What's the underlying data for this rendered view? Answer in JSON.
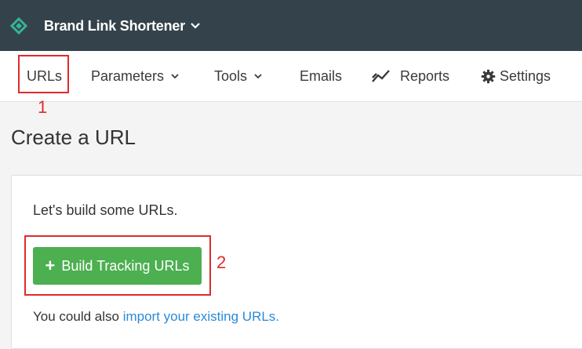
{
  "header": {
    "brand_name": "Brand Link Shortener",
    "brand_color": "#35b39a",
    "background": "#34434b"
  },
  "nav": {
    "items": [
      {
        "label": "URLs",
        "icon": null,
        "dropdown": false
      },
      {
        "label": "Parameters",
        "icon": "chevron-down-icon",
        "dropdown": true
      },
      {
        "label": "Tools",
        "icon": "chevron-down-icon",
        "dropdown": true
      },
      {
        "label": "Emails",
        "icon": null,
        "dropdown": false
      },
      {
        "label": "Reports",
        "icon": "line-chart-icon",
        "dropdown": false
      },
      {
        "label": "Settings",
        "icon": "gear-icon",
        "dropdown": false
      }
    ]
  },
  "annotations": {
    "first": "1",
    "second": "2",
    "color": "#e02b2b"
  },
  "main": {
    "title": "Create a URL",
    "intro": "Let's build some URLs.",
    "build_button": {
      "icon": "plus-icon",
      "label": "Build Tracking URLs",
      "color": "#4caf50"
    },
    "also_prefix": "You could also ",
    "import_link": "import your existing URLs."
  }
}
